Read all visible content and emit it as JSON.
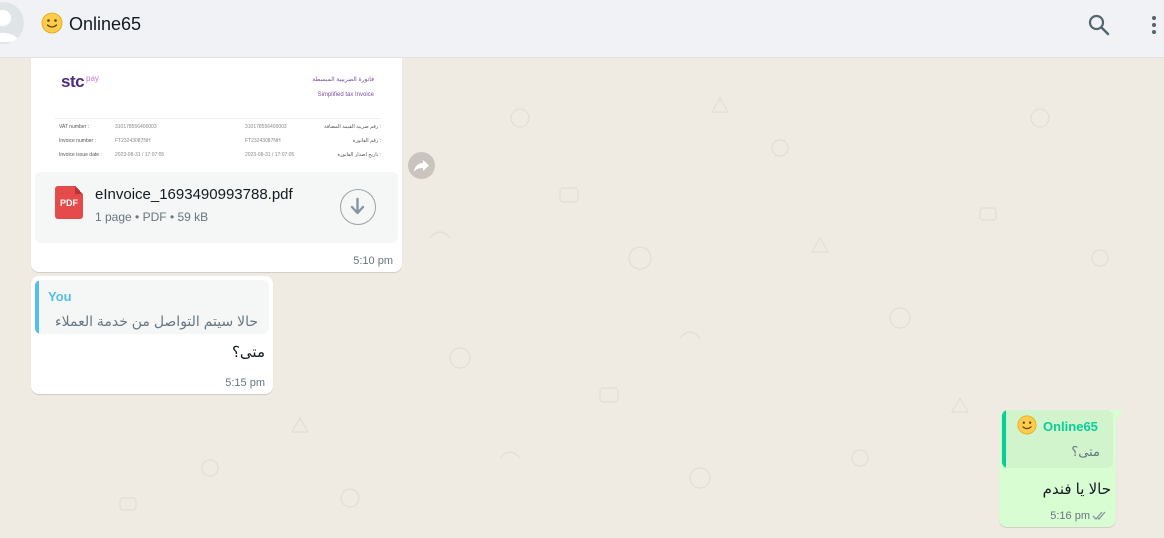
{
  "header": {
    "contact_name": "Online65",
    "emoji": "slightly-smiling-face",
    "search_icon": "search-icon",
    "menu_icon": "kebab-menu-icon"
  },
  "colors": {
    "header_bg": "#f0f2f5",
    "chat_bg": "#efeae2",
    "incoming_bubble": "#ffffff",
    "outgoing_bubble": "#d9fdd3",
    "quote_you": "#53bdeb",
    "quote_contact": "#06cf9c",
    "pdf_red": "#e64b4b"
  },
  "messages": {
    "document": {
      "preview": {
        "brand": "stc",
        "brand_suffix": "pay",
        "title_ar": "فاتورة الضريبية المبسطة",
        "title_en": "Simplified tax Invoice",
        "rows": [
          {
            "label_en": "VAT number :",
            "value_en": "310178556400003",
            "value_ar": "310178556400003",
            "label_ar": "رقم ضريبة القيمة المضافة :"
          },
          {
            "label_en": "Invoice number :",
            "value_en": "FT23243087NH",
            "value_ar": "FT23243087NH",
            "label_ar": "رقم الفاتورة :"
          },
          {
            "label_en": "Invoice issue date :",
            "value_en": "2023-08-31 / 17:07:05",
            "value_ar": "2023-08-31 / 17:07:05",
            "label_ar": "تاريخ اصدار الفاتورة :"
          }
        ]
      },
      "file_name": "eInvoice_1693490993788.pdf",
      "file_type_badge": "PDF",
      "pages": "1 page",
      "type": "PDF",
      "size": "59 kB",
      "separator": "•",
      "time": "5:10 pm"
    },
    "reply_incoming": {
      "quote_author": "You",
      "quote_text": "حالا سيتم التواصل من خدمة العملاء",
      "text": "متى؟",
      "time": "5:15 pm"
    },
    "reply_outgoing": {
      "quote_author": "Online65",
      "quote_text": "متى؟",
      "text": "حالا يا فندم",
      "time": "5:16 pm",
      "status": "read-double-check"
    }
  }
}
